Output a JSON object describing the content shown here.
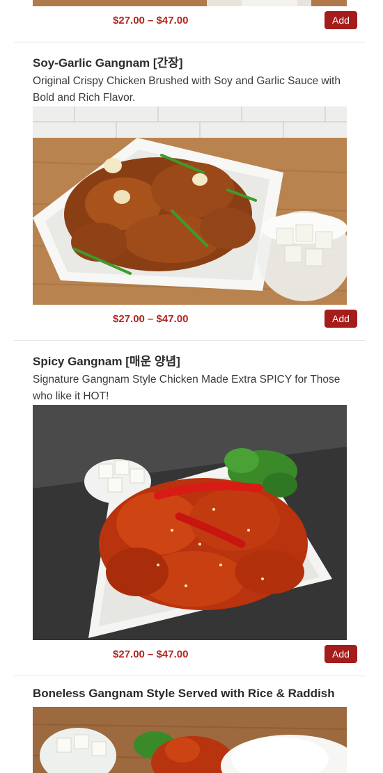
{
  "items": [
    {
      "price": "$27.00 – $47.00",
      "add_label": "Add"
    },
    {
      "title": "Soy-Garlic Gangnam [간장]",
      "description": "Original Crispy Chicken Brushed with Soy and Garlic Sauce with Bold and Rich Flavor.",
      "price": "$27.00 – $47.00",
      "add_label": "Add"
    },
    {
      "title": "Spicy Gangnam [매운 양념]",
      "description": "Signature Gangnam Style Chicken Made Extra SPICY for Those who like it HOT!",
      "price": "$27.00 – $47.00",
      "add_label": "Add"
    },
    {
      "title": "Boneless Gangnam Style Served with Rice & Raddish"
    }
  ],
  "colors": {
    "price": "#b3261e",
    "add_button": "#a51c1c",
    "divider": "#e5e5e5"
  }
}
